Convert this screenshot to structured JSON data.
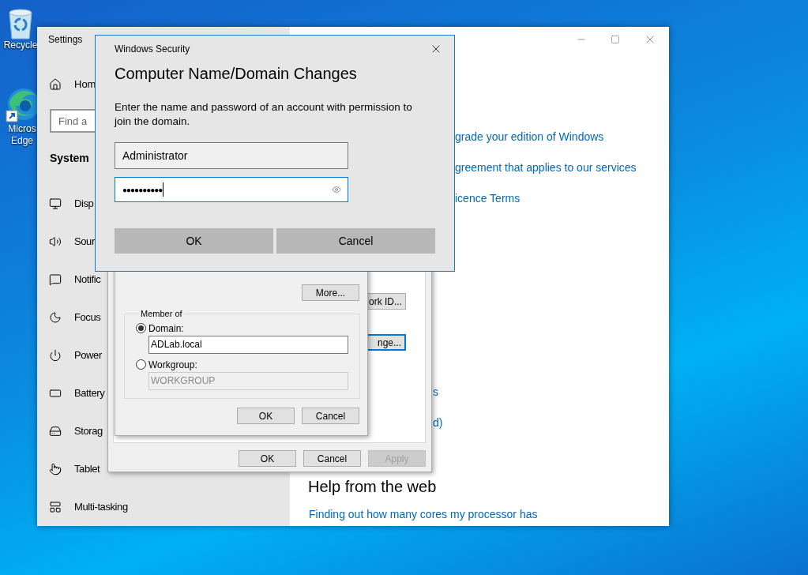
{
  "desktop": {
    "icons": [
      {
        "lines": [
          "Recycle"
        ]
      },
      {
        "lines": [
          "Micros",
          "Edge"
        ]
      }
    ]
  },
  "settings": {
    "title": "Settings",
    "home": "Hom",
    "search": {
      "placeholder": "Find a"
    },
    "section": "System",
    "items": [
      {
        "label": "Disp"
      },
      {
        "label": "Sour"
      },
      {
        "label": "Notific"
      },
      {
        "label": "Focus"
      },
      {
        "label": "Power"
      },
      {
        "label": "Battery"
      },
      {
        "label": "Storag"
      },
      {
        "label": "Tablet"
      },
      {
        "label": "Multi-tasking"
      }
    ],
    "links": [
      "grade your edition of Windows",
      "greement that applies to our services",
      "icence Terms"
    ],
    "side_links": [
      "s",
      "d)"
    ],
    "help_heading": "Help from the web",
    "help_link": "Finding out how many cores my processor has"
  },
  "system_properties": {
    "side_buttons": [
      {
        "label": "ork ID...",
        "focused": false
      },
      {
        "label": "nge...",
        "focused": true
      }
    ],
    "buttons": [
      {
        "label": "OK",
        "disabled": false
      },
      {
        "label": "Cancel",
        "disabled": false
      },
      {
        "label": "Apply",
        "disabled": true
      }
    ]
  },
  "computer_name_dialog": {
    "more_button": "More...",
    "group": "Member of",
    "options": [
      {
        "label": "Domain:",
        "selected": true,
        "value": "ADLab.local"
      },
      {
        "label": "Workgroup:",
        "selected": false,
        "value": "WORKGROUP"
      }
    ],
    "buttons": [
      "OK",
      "Cancel"
    ]
  },
  "security_dialog": {
    "title": "Windows Security",
    "heading": "Computer Name/Domain Changes",
    "message": "Enter the name and password of an account with permission to join the domain.",
    "username": {
      "value": "Administrator",
      "focused": false
    },
    "password": {
      "value": "●●●●●●●●●●",
      "focused": true
    },
    "buttons": [
      "OK",
      "Cancel"
    ]
  }
}
